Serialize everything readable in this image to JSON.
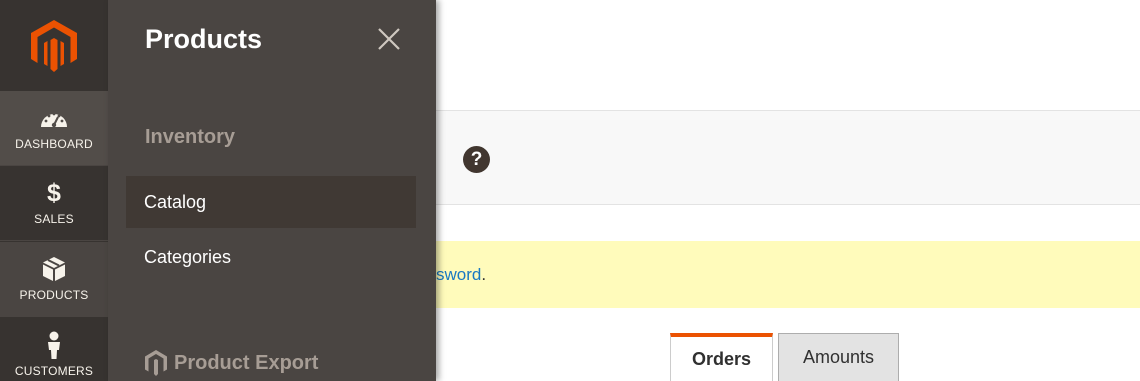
{
  "admin_nav": {
    "logo_icon": "magento-logo-icon",
    "brand_color": "#eb5202",
    "items": [
      {
        "label": "DASHBOARD",
        "icon": "speedometer-icon"
      },
      {
        "label": "SALES",
        "icon": "dollar-icon"
      },
      {
        "label": "PRODUCTS",
        "icon": "cube-icon"
      },
      {
        "label": "CUSTOMERS",
        "icon": "person-icon"
      }
    ]
  },
  "products_panel": {
    "title": "Products",
    "close_icon": "close-icon",
    "sections": [
      {
        "title": "Inventory",
        "links": [
          "Catalog",
          "Categories"
        ]
      }
    ],
    "export_title": "Product Export",
    "export_icon": "product-export-logo-icon"
  },
  "page": {
    "help_glyph": "?",
    "message_link_fragment": "sword",
    "message_after": "."
  },
  "tabs": {
    "orders_label": "Orders",
    "amounts_label": "Amounts",
    "active_accent": "#eb5202"
  }
}
